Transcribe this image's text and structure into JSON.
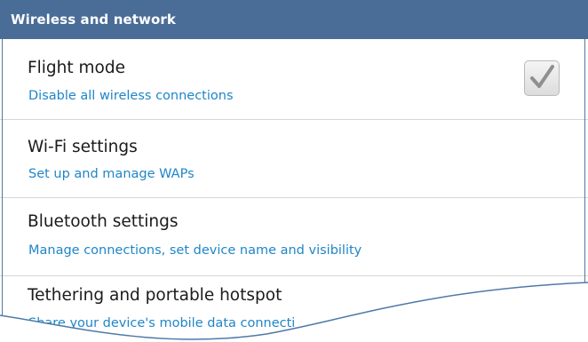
{
  "header": {
    "title": "Wireless and network"
  },
  "items": [
    {
      "title": "Flight mode",
      "subtitle": "Disable all wireless connections",
      "checked": true
    },
    {
      "title": "Wi-Fi settings",
      "subtitle": "Set up and manage WAPs"
    },
    {
      "title": "Bluetooth settings",
      "subtitle": "Manage connections, set device name and visibility"
    },
    {
      "title": "Tethering and portable hotspot",
      "subtitle": "Share your device's mobile data connecti"
    }
  ],
  "icons": {
    "checkbox": "check-icon"
  },
  "colors": {
    "header_bg": "#4a6d98",
    "subtitle": "#1f86c8",
    "divider": "#d6d6d6",
    "frame": "#4f79a8"
  }
}
